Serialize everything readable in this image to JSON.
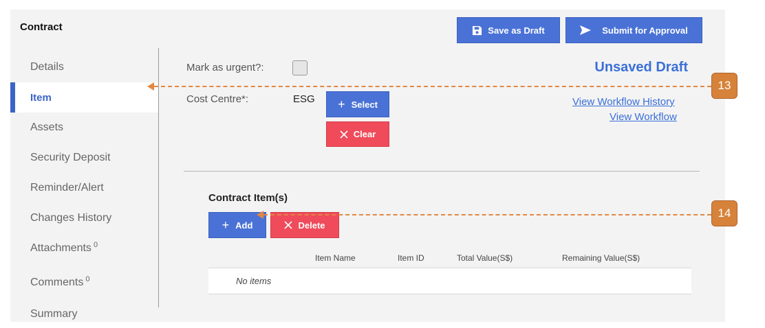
{
  "header": {
    "title": "Contract",
    "save_draft_label": "Save as Draft",
    "submit_label": "Submit for Approval"
  },
  "sidebar": {
    "items": [
      {
        "label": "Details",
        "sup": ""
      },
      {
        "label": "Item",
        "sup": "",
        "active": true
      },
      {
        "label": "Assets",
        "sup": ""
      },
      {
        "label": "Security Deposit",
        "sup": ""
      },
      {
        "label": "Reminder/Alert",
        "sup": ""
      },
      {
        "label": "Changes History",
        "sup": ""
      },
      {
        "label": "Attachments",
        "sup": "0"
      },
      {
        "label": "Comments",
        "sup": "0"
      },
      {
        "label": "Summary",
        "sup": ""
      }
    ]
  },
  "form": {
    "urgent_label": "Mark as urgent?:",
    "urgent_checked": false,
    "cost_centre_label": "Cost Centre*:",
    "cost_centre_value": "ESG",
    "select_label": "Select",
    "clear_label": "Clear"
  },
  "status": {
    "draft_label": "Unsaved Draft",
    "workflow_history_link": "View Workflow History",
    "workflow_link": "View Workflow"
  },
  "items_section": {
    "title": "Contract Item(s)",
    "add_label": "Add",
    "delete_label": "Delete",
    "columns": [
      "Item Name",
      "Item ID",
      "Total Value(S$)",
      "Remaining Value(S$)"
    ],
    "empty_text": "No items"
  },
  "callouts": [
    "13",
    "14"
  ],
  "colors": {
    "accent": "#3a64c8",
    "primary_button": "#4a72d6",
    "danger_button": "#ef4b5a",
    "callout": "#d7823a"
  },
  "icons": {
    "save": "floppy-disk-icon",
    "submit": "send-arrow-icon",
    "plus": "plus-icon",
    "clear": "x-icon"
  }
}
